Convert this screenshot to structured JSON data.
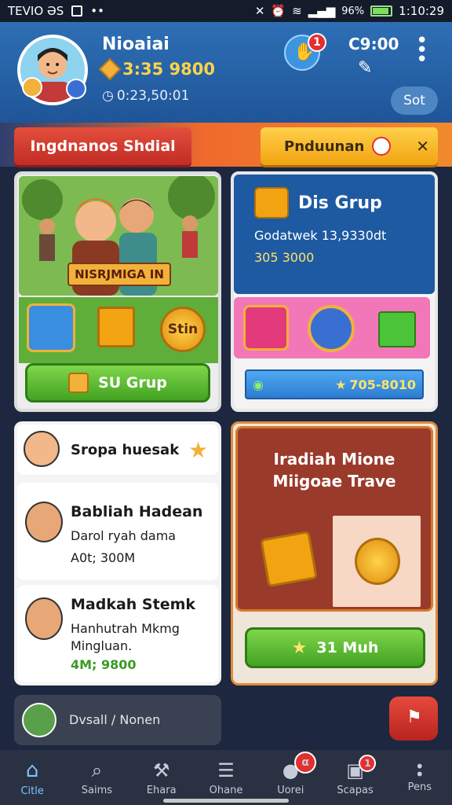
{
  "status_bar": {
    "carrier": "TEVIO ƏS",
    "battery": "96%",
    "time": "1:10:29"
  },
  "header": {
    "username": "Nioaiai",
    "coins": "3:35 9800",
    "sub_value": "0:23,50:01",
    "notif_count": "1",
    "score_label": "C9:00",
    "sot_button": "Sot"
  },
  "banners": {
    "left": "Ingdnanos Shdial",
    "right": "Pnduunan"
  },
  "card_event": {
    "plate": "NISRJMIGA IN",
    "coin_label": "Stin",
    "button": "SU Grup"
  },
  "card_group": {
    "title": "Dis Grup",
    "line1": "Godatwek 13,9330dt",
    "line2": "305 3000",
    "bar_value": "705-8010"
  },
  "friends": [
    {
      "name": "Sropa huesak"
    },
    {
      "name": "Babliah Hadean",
      "line": "Darol ryah dama",
      "amount": "A0t; 300M"
    },
    {
      "name": "Madkah Stemk",
      "line": "Hanhutrah Mkmg",
      "line2": "Mingluan.",
      "amount": "4M; 9800"
    }
  ],
  "reward_card": {
    "title_line1": "Iradiah Mione",
    "title_line2": "Miigoae Trave",
    "button": "31 Muh"
  },
  "bottom_row": {
    "label": "Dvsall / Nonen"
  },
  "nav": [
    {
      "label": "Citle",
      "icon": "home-icon"
    },
    {
      "label": "Saims",
      "icon": "search-icon"
    },
    {
      "label": "Ehara",
      "icon": "hammer-icon"
    },
    {
      "label": "Ohane",
      "icon": "shop-icon"
    },
    {
      "label": "Uorei",
      "icon": "chat-icon",
      "badge": "α"
    },
    {
      "label": "Scapas",
      "icon": "gift-icon",
      "badge": "1"
    },
    {
      "label": "Pens",
      "icon": "more-icon"
    }
  ],
  "colors": {
    "header": "#2e6fb5",
    "accent_green": "#5fae3a",
    "accent_orange": "#f2a312",
    "accent_red": "#c12c25"
  }
}
